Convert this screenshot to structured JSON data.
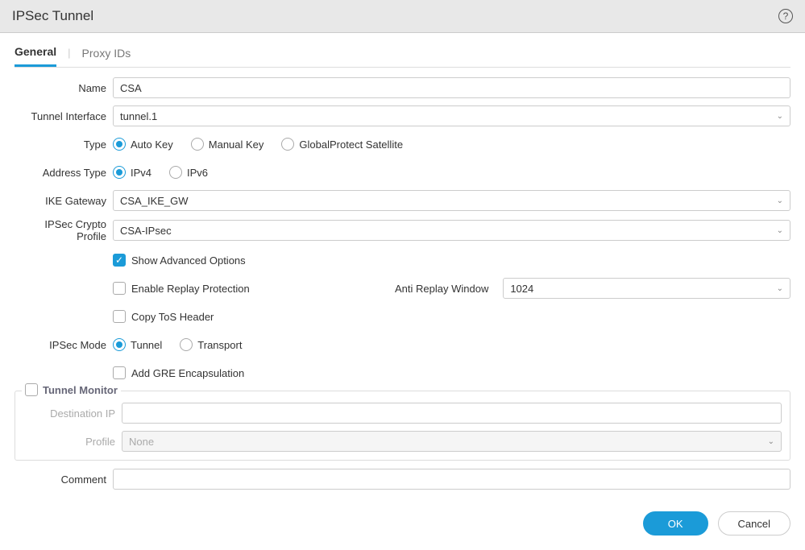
{
  "header": {
    "title": "IPSec Tunnel"
  },
  "tabs": {
    "general": "General",
    "proxy_ids": "Proxy IDs"
  },
  "labels": {
    "name": "Name",
    "tunnel_interface": "Tunnel Interface",
    "type": "Type",
    "address_type": "Address Type",
    "ike_gateway": "IKE Gateway",
    "crypto_profile": "IPSec Crypto Profile",
    "ipsec_mode": "IPSec Mode",
    "anti_replay": "Anti Replay Window",
    "destination_ip": "Destination IP",
    "profile": "Profile",
    "comment": "Comment"
  },
  "values": {
    "name": "CSA",
    "tunnel_interface": "tunnel.1",
    "ike_gateway": "CSA_IKE_GW",
    "crypto_profile": "CSA-IPsec",
    "anti_replay": "1024",
    "destination_ip": "",
    "profile": "None",
    "comment": ""
  },
  "type_options": {
    "auto": "Auto Key",
    "manual": "Manual Key",
    "satellite": "GlobalProtect Satellite"
  },
  "address_options": {
    "ipv4": "IPv4",
    "ipv6": "IPv6"
  },
  "checkboxes": {
    "show_advanced": "Show Advanced Options",
    "enable_replay": "Enable Replay Protection",
    "copy_tos": "Copy ToS Header",
    "add_gre": "Add GRE Encapsulation"
  },
  "ipsec_mode_options": {
    "tunnel": "Tunnel",
    "transport": "Transport"
  },
  "fieldset": {
    "tunnel_monitor": "Tunnel Monitor"
  },
  "buttons": {
    "ok": "OK",
    "cancel": "Cancel"
  }
}
